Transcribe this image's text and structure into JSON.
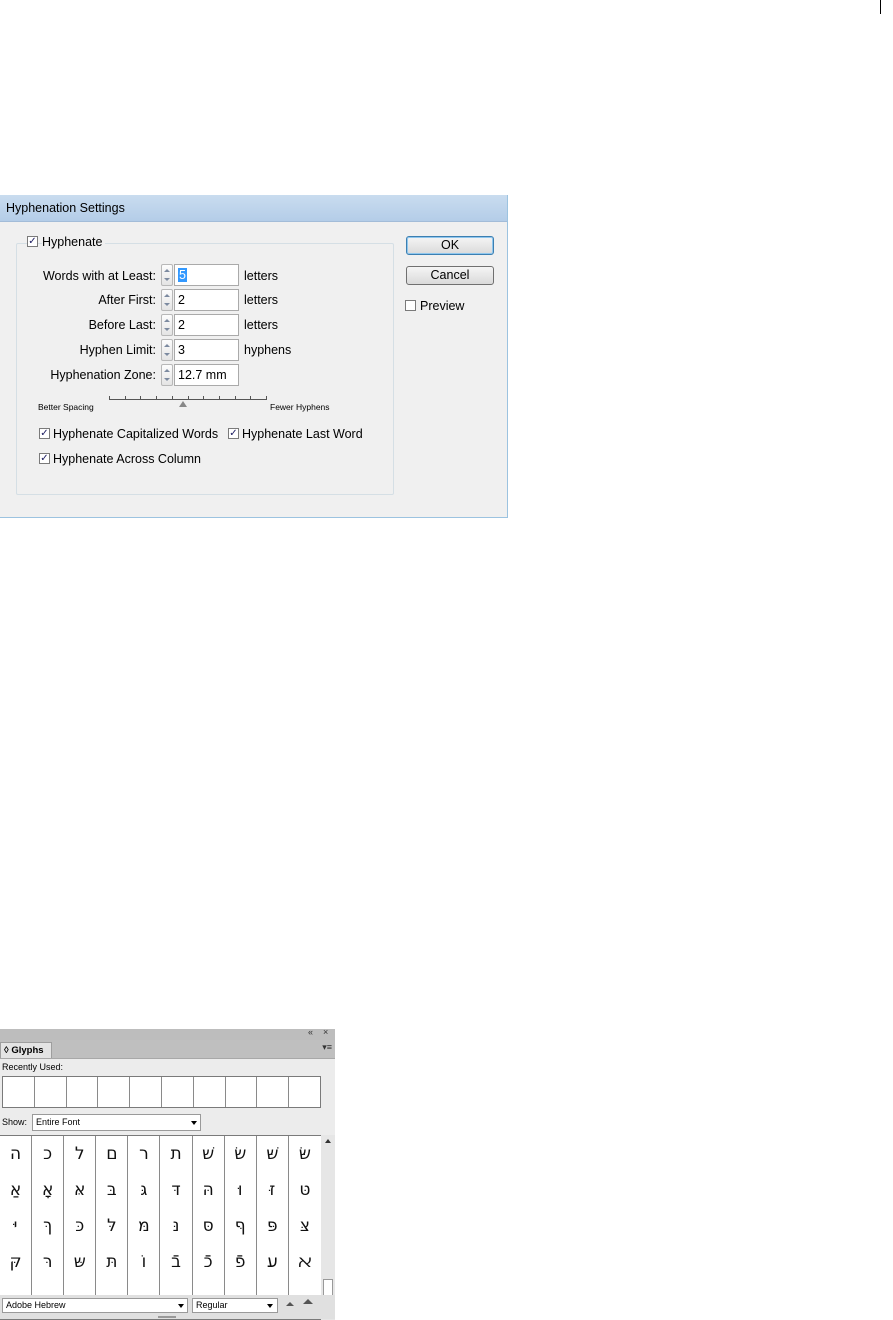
{
  "hyphenation_dialog": {
    "title": "Hyphenation Settings",
    "hyphenate_label": "Hyphenate",
    "hyphenate_checked": true,
    "fields": [
      {
        "label": "Words with at Least:",
        "value": "5",
        "unit": "letters"
      },
      {
        "label": "After First:",
        "value": "2",
        "unit": "letters"
      },
      {
        "label": "Before Last:",
        "value": "2",
        "unit": "letters"
      },
      {
        "label": "Hyphen Limit:",
        "value": "3",
        "unit": "hyphens"
      },
      {
        "label": "Hyphenation Zone:",
        "value": "12.7 mm",
        "unit": ""
      }
    ],
    "slider": {
      "left_label": "Better Spacing",
      "right_label": "Fewer Hyphens",
      "value_fraction": 0.47
    },
    "options": [
      {
        "label": "Hyphenate Capitalized Words",
        "checked": true
      },
      {
        "label": "Hyphenate Last Word",
        "checked": true
      },
      {
        "label": "Hyphenate Across Column",
        "checked": true
      }
    ],
    "ok_label": "OK",
    "cancel_label": "Cancel",
    "preview_label": "Preview",
    "preview_checked": false
  },
  "glyphs_panel": {
    "tab_label": "◊ Glyphs",
    "recently_used_label": "Recently Used:",
    "show_label": "Show:",
    "show_value": "Entire Font",
    "glyph_rows": [
      [
        "ה",
        "כ",
        "ל",
        "ם",
        "ר",
        "ת",
        "שׁ",
        "שׂ",
        "שּׁ",
        "שּׂ"
      ],
      [
        "אַ",
        "אָ",
        "אּ",
        "בּ",
        "גּ",
        "דּ",
        "הּ",
        "וּ",
        "זּ",
        "טּ"
      ],
      [
        "יּ",
        "ךּ",
        "כּ",
        "לּ",
        "מּ",
        "נּ",
        "סּ",
        "ףּ",
        "פּ",
        "צּ"
      ],
      [
        "קּ",
        "רּ",
        "שּ",
        "תּ",
        "וֹ",
        "בֿ",
        "כֿ",
        "פֿ",
        "ﬠ",
        "ﬡ"
      ]
    ],
    "font_family": "Adobe Hebrew",
    "font_style": "Regular"
  }
}
